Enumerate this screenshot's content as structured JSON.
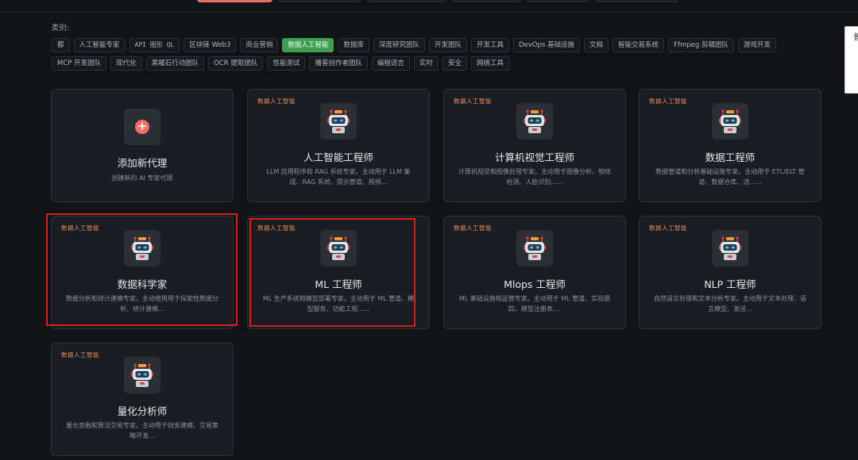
{
  "category_label": "类别:",
  "categories_row1": [
    "都",
    "人工智能专家",
    "API 图形 QL",
    "区块链 Web3",
    "商业营销",
    "数据人工智能",
    "数据库",
    "深度研究团队",
    "开发团队",
    "开发工具",
    "DevOps 基础设施",
    "文档",
    "智能交易系统",
    "Ffmpeg 剪辑团队",
    "游戏开发"
  ],
  "categories_row2": [
    "MCP 开发团队",
    "现代化",
    "黑曜石行动团队",
    "OCR 提取团队",
    "性能测试",
    "播客创作者团队",
    "编程语言",
    "实时",
    "安全",
    "网络工具"
  ],
  "selected_category": "数据人工智能",
  "side_panel_text": "普",
  "add_card": {
    "title": "添加新代理",
    "desc": "创建新的 AI 专家代理"
  },
  "agents": [
    {
      "tag": "数据人工智能",
      "title": "人工智能工程师",
      "desc": "LLM 应用程序和 RAG 系统专家。主动用于 LLM 集成、RAG 系统、提示管道、视频..."
    },
    {
      "tag": "数据人工智能",
      "title": "计算机视觉工程师",
      "desc": "计算机视觉和图像处理专家。主动用于图像分析、物体检测、人脸识别......"
    },
    {
      "tag": "数据人工智能",
      "title": "数据工程师",
      "desc": "数据管道和分析基础设施专家。主动用于 ETL/ELT 管道、数据仓库、流......"
    },
    {
      "tag": "数据人工智能",
      "title": "数据科学家",
      "desc": "数据分析和统计建模专家。主动使用用于探索性数据分析、统计建模..."
    },
    {
      "tag": "数据人工智能",
      "title": "ML 工程师",
      "desc": "ML 生产系统和模型部署专家。主动用于 ML 管道、模型服务、功能工程......"
    },
    {
      "tag": "数据人工智能",
      "title": "Mlops 工程师",
      "desc": "ML 基础设施和运营专家。主动用于 ML 管道、实验跟踪、模型注册表...."
    },
    {
      "tag": "数据人工智能",
      "title": "NLP 工程师",
      "desc": "自然语言处理和文本分析专家。主动用于文本处理、语言模型、发送..."
    },
    {
      "tag": "数据人工智能",
      "title": "量化分析师",
      "desc": "量化金融和算法交易专家。主动用于财务建模、交易策略开发..."
    }
  ],
  "colors": {
    "accent": "#e8715f",
    "selected_chip": "#3fa052",
    "tag": "#e98a5c",
    "highlight": "#d71f1f"
  }
}
